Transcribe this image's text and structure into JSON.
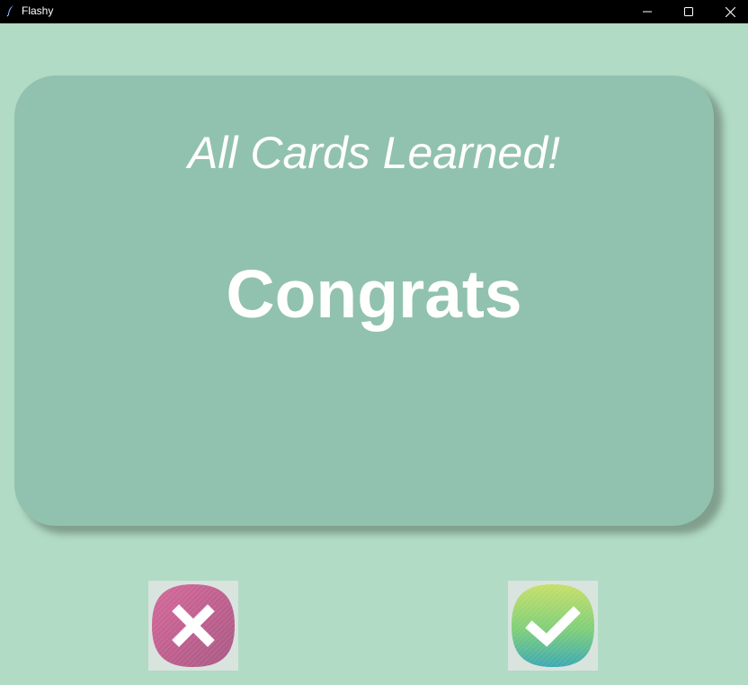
{
  "window": {
    "title": "Flashy",
    "app_icon": "feather-icon",
    "controls": [
      "minimize-icon",
      "maximize-icon",
      "close-icon"
    ]
  },
  "card": {
    "title": "All Cards Learned!",
    "word": "Congrats"
  },
  "buttons": {
    "wrong_icon": "cross-icon",
    "right_icon": "checkmark-icon"
  },
  "colors": {
    "background": "#b1dbc5",
    "card": "#91c2af",
    "text": "#ffffff",
    "wrong_button": "#c0608f",
    "right_button": "#8fd36a"
  }
}
